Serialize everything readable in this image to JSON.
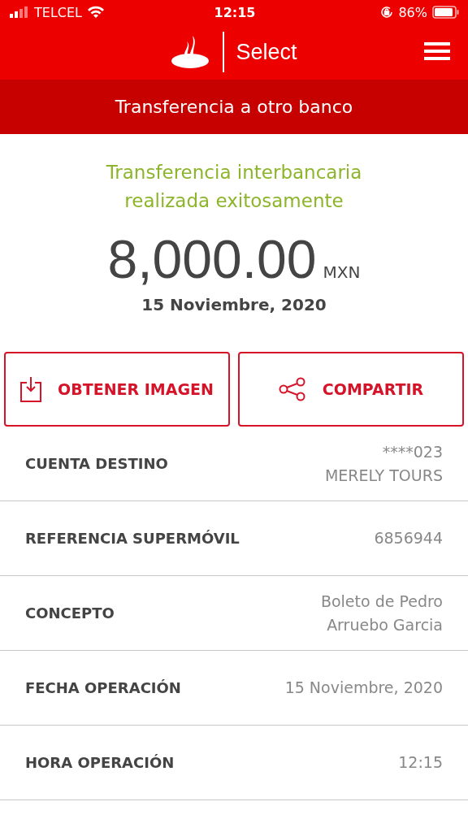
{
  "status_bar": {
    "carrier": "TELCEL",
    "time": "12:15",
    "battery": "86%"
  },
  "header": {
    "brand": "Select"
  },
  "title_bar": {
    "title": "Transferencia a otro banco"
  },
  "receipt": {
    "message": "Transferencia interbancaria realizada exitosamente",
    "amount": "8,000.00",
    "currency": "MXN",
    "date": "15 Noviembre, 2020"
  },
  "actions": [
    {
      "kind": "download",
      "label": "OBTENER IMAGEN"
    },
    {
      "kind": "share",
      "label": "COMPARTIR"
    }
  ],
  "details": [
    {
      "label": "CUENTA DESTINO",
      "value": [
        "****023",
        "MERELY TOURS"
      ]
    },
    {
      "label": "REFERENCIA SUPERMÓVIL",
      "value": [
        "6856944"
      ]
    },
    {
      "label": "CONCEPTO",
      "value": [
        "Boleto de Pedro",
        "Arruebo Garcia"
      ]
    },
    {
      "label": "FECHA OPERACIÓN",
      "value": [
        "15 Noviembre, 2020"
      ]
    },
    {
      "label": "HORA OPERACIÓN",
      "value": [
        "12:15"
      ]
    }
  ]
}
